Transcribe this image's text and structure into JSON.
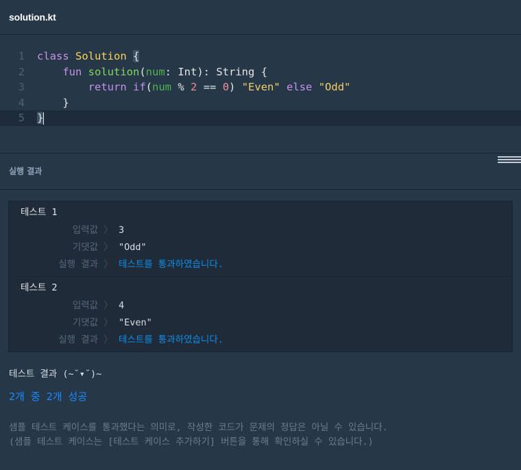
{
  "tab": {
    "title": "solution.kt"
  },
  "editor": {
    "line_numbers": [
      "1",
      "2",
      "3",
      "4",
      "5"
    ],
    "code": {
      "l1": {
        "kw": "class",
        "cls": "Solution",
        "brace": "{"
      },
      "l2": {
        "kw": "fun",
        "fn": "solution",
        "open": "(",
        "param": "num",
        "colon": ": ",
        "ptype": "Int",
        "close": "): ",
        "rtype": "String",
        "brace": "{"
      },
      "l3": {
        "kw": "return",
        "kw_if": "if",
        "open": "(",
        "param": "num",
        "op1": " % ",
        "n2": "2",
        "op2": " == ",
        "n0": "0",
        "close": ") ",
        "s1": "\"Even\"",
        "kw_else": "else",
        "s2": "\"Odd\""
      },
      "l4": {
        "brace": "}"
      },
      "l5": {
        "brace": "}"
      }
    }
  },
  "result_panel": {
    "title": "실행 결과",
    "cases": [
      {
        "title": "테스트 1",
        "input_label": "입력값",
        "input": "3",
        "expected_label": "기댓값",
        "expected": "\"Odd\"",
        "result_label": "실행 결과",
        "result": "테스트를 통과하였습니다."
      },
      {
        "title": "테스트 2",
        "input_label": "입력값",
        "input": "4",
        "expected_label": "기댓값",
        "expected": "\"Even\"",
        "result_label": "실행 결과",
        "result": "테스트를 통과하였습니다."
      }
    ],
    "arrow": "〉",
    "summary": {
      "title": "테스트 결과 (~˘▾˘)~",
      "count": "2개 중 2개 성공",
      "note1": "샘플 테스트 케이스를 통과했다는 의미로, 작성한 코드가 문제의 정답은 아닐 수 있습니다.",
      "note2": "(샘플 테스트 케이스는 [테스트 케이스 추가하기] 버튼을 통해 확인하실 수 있습니다.)"
    }
  },
  "colors": {
    "background": "#263747",
    "pass": "#0c8fe8",
    "count": "#1b8bff"
  }
}
